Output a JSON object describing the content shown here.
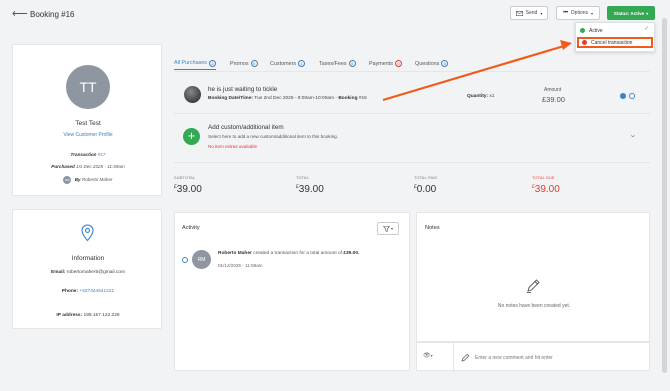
{
  "header": {
    "back_icon": "arrow-left-icon",
    "title": "Booking #16",
    "send_label": "Send",
    "options_label": "Options",
    "status_label": "Status: Active"
  },
  "status_menu": {
    "items": [
      {
        "label": "Active",
        "color": "#34a853"
      },
      {
        "label": "Cancel transaction",
        "color": "#e53935"
      }
    ]
  },
  "profile": {
    "initials": "TT",
    "name": "Test Test",
    "view_link": "View Customer Profile",
    "transaction_label": "Transaction",
    "transaction_id": "#17",
    "purchased_label": "Purchased",
    "purchased_value": "1st Dec 2025 - 11:59am",
    "by_avatar": "RM",
    "by_label": "By",
    "by_name": "Roberto Maher"
  },
  "information": {
    "title": "Information",
    "email_label": "Email:",
    "email": "robertomaher5@gmail.com",
    "phone_label": "Phone:",
    "phone": "+527444541221",
    "ip_label": "IP address:",
    "ip": "189.157.122.228"
  },
  "tabs": [
    {
      "label": "All Purchases",
      "count": "2"
    },
    {
      "label": "Promos",
      "count": "0"
    },
    {
      "label": "Customers",
      "count": "1"
    },
    {
      "label": "Taxes/Fees",
      "count": "0"
    },
    {
      "label": "Payments",
      "count": "0"
    },
    {
      "label": "Questions",
      "count": "0"
    }
  ],
  "purchase": {
    "name": "he is just waiting to tickle",
    "date_label": "Booking Date/Time:",
    "date_value": "Tue 2nd Dec 2025 - 9:00am-10:00am -",
    "booking_label": "Booking",
    "booking_id": "#16",
    "qty_label": "Quantity:",
    "qty_value": "x1",
    "amount_label": "Amount",
    "amount_value": "£39.00"
  },
  "add_item": {
    "title": "Add custom/additional item",
    "description": "Select here to add a new custom/additional item to this booking.",
    "note": "No item extras available"
  },
  "totals": {
    "subtotal_label": "SUBTOTAL",
    "subtotal_currency": "£",
    "subtotal_value": "39.00",
    "total_label": "TOTAL",
    "total_currency": "£",
    "total_value": "39.00",
    "paid_label": "TOTAL PAID",
    "paid_currency": "£",
    "paid_value": "0.00",
    "due_label": "TOTAL DUE",
    "due_currency": "£",
    "due_value": "39.00"
  },
  "activity": {
    "title": "Activity",
    "avatar": "RM",
    "actor": "Roberto Maher",
    "action": "created a transaction for a total amount of",
    "amount": "£39.00.",
    "time": "01/12/2025 - 11:59am"
  },
  "notes": {
    "title": "Notes",
    "empty": "No notes have been created yet.",
    "comment_placeholder": "Enter a new comment and hit enter"
  },
  "colors": {
    "accent": "#3b82c4",
    "success": "#34a853",
    "danger": "#e53935",
    "annotation": "#f05a1a"
  }
}
